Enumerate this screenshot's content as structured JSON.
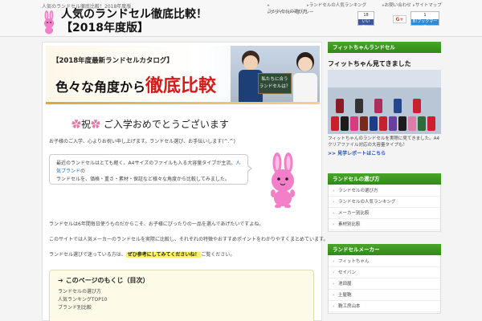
{
  "header": {
    "tagline": "人気のランドセル徹底比較！2018年度版",
    "site_title_line1": "人気のランドセル徹底比較！",
    "site_title_line2": "【2018年度版】",
    "nav": [
      "ランドセルの選び方",
      "ランドセルの人気ランキング",
      "お問い合わせ",
      "サイトマップ",
      "プライバシーポリシー"
    ],
    "share": {
      "like_count": "18",
      "like_label": "いいね！",
      "gplus_label": "G+",
      "hatena_count": "1",
      "hatena_label": "B!ブックマーク"
    }
  },
  "hero": {
    "catalog": "【2018年度最新ランドセルカタログ】",
    "heading_prefix": "色々な角度から",
    "heading_emphasis": "徹底比較",
    "sign_line1": "私たちに合う",
    "sign_line2": "ランドセルは？"
  },
  "main": {
    "congrats_flower": "✿",
    "congrats_flower2": "祝",
    "congrats_text": "ご入学おめでとうございます",
    "intro": "お子様のご入学、心よりお祝い申し上げます。ランドセル選び、お手伝いします(^.^)",
    "bubble_line1_a": "最近のランドセルはとても軽く、A4サイズのファイルも入る大容量タイプが主流。",
    "bubble_link": "人気ブランド",
    "bubble_line1_b": "の",
    "bubble_line2": "ランドセルを、価格・重さ・素材・保証など様々な角度から比較してみました。",
    "para1": "ランドセルは6年間毎日使うものだからこそ、お子様にぴったりの一品を選んであげたいですよね。",
    "para2": "このサイトでは人気メーカーのランドセルを実際に比較し、それぞれの特徴やおすすめポイントをわかりやすくまとめています。",
    "para3_a": "ランドセル選びで迷っている方は、",
    "para3_highlight": "ぜひ参考にしてみてくださいね！",
    "para3_b": "ご覧ください。",
    "toc_arrow": "➔",
    "toc_title": "このページのもくじ（目次）",
    "toc_items": [
      "ランドセルの選び方",
      "人気ランキングTOP10",
      "ブランド別比較"
    ]
  },
  "sidebar": {
    "widget1_title": "フィットちゃんランドセル",
    "fit_caption": "フィットちゃん見てきました",
    "fit_desc": "フィットちゃんのランドセルを実際に見てきました。A4クリアファイル対応の大容量タイプも！",
    "fit_more": ">> 見学レポートはこちら",
    "widget2_title": "ランドセルの選び方",
    "widget2_items": [
      "ランドセルの選び方",
      "ランドセルの人気ランキング",
      "メーカー別比較",
      "素材別比較"
    ],
    "widget3_title": "ランドセルメーカー",
    "widget3_items": [
      "フィットちゃん",
      "セイバン",
      "池田屋",
      "土屋鞄",
      "鞄工房山本"
    ]
  },
  "colors": {
    "accent_green": "#2f8a16",
    "emphasis_red": "#d61a1a",
    "highlight_yellow": "#fff25a",
    "mascot_pink": "#f27fc7"
  }
}
